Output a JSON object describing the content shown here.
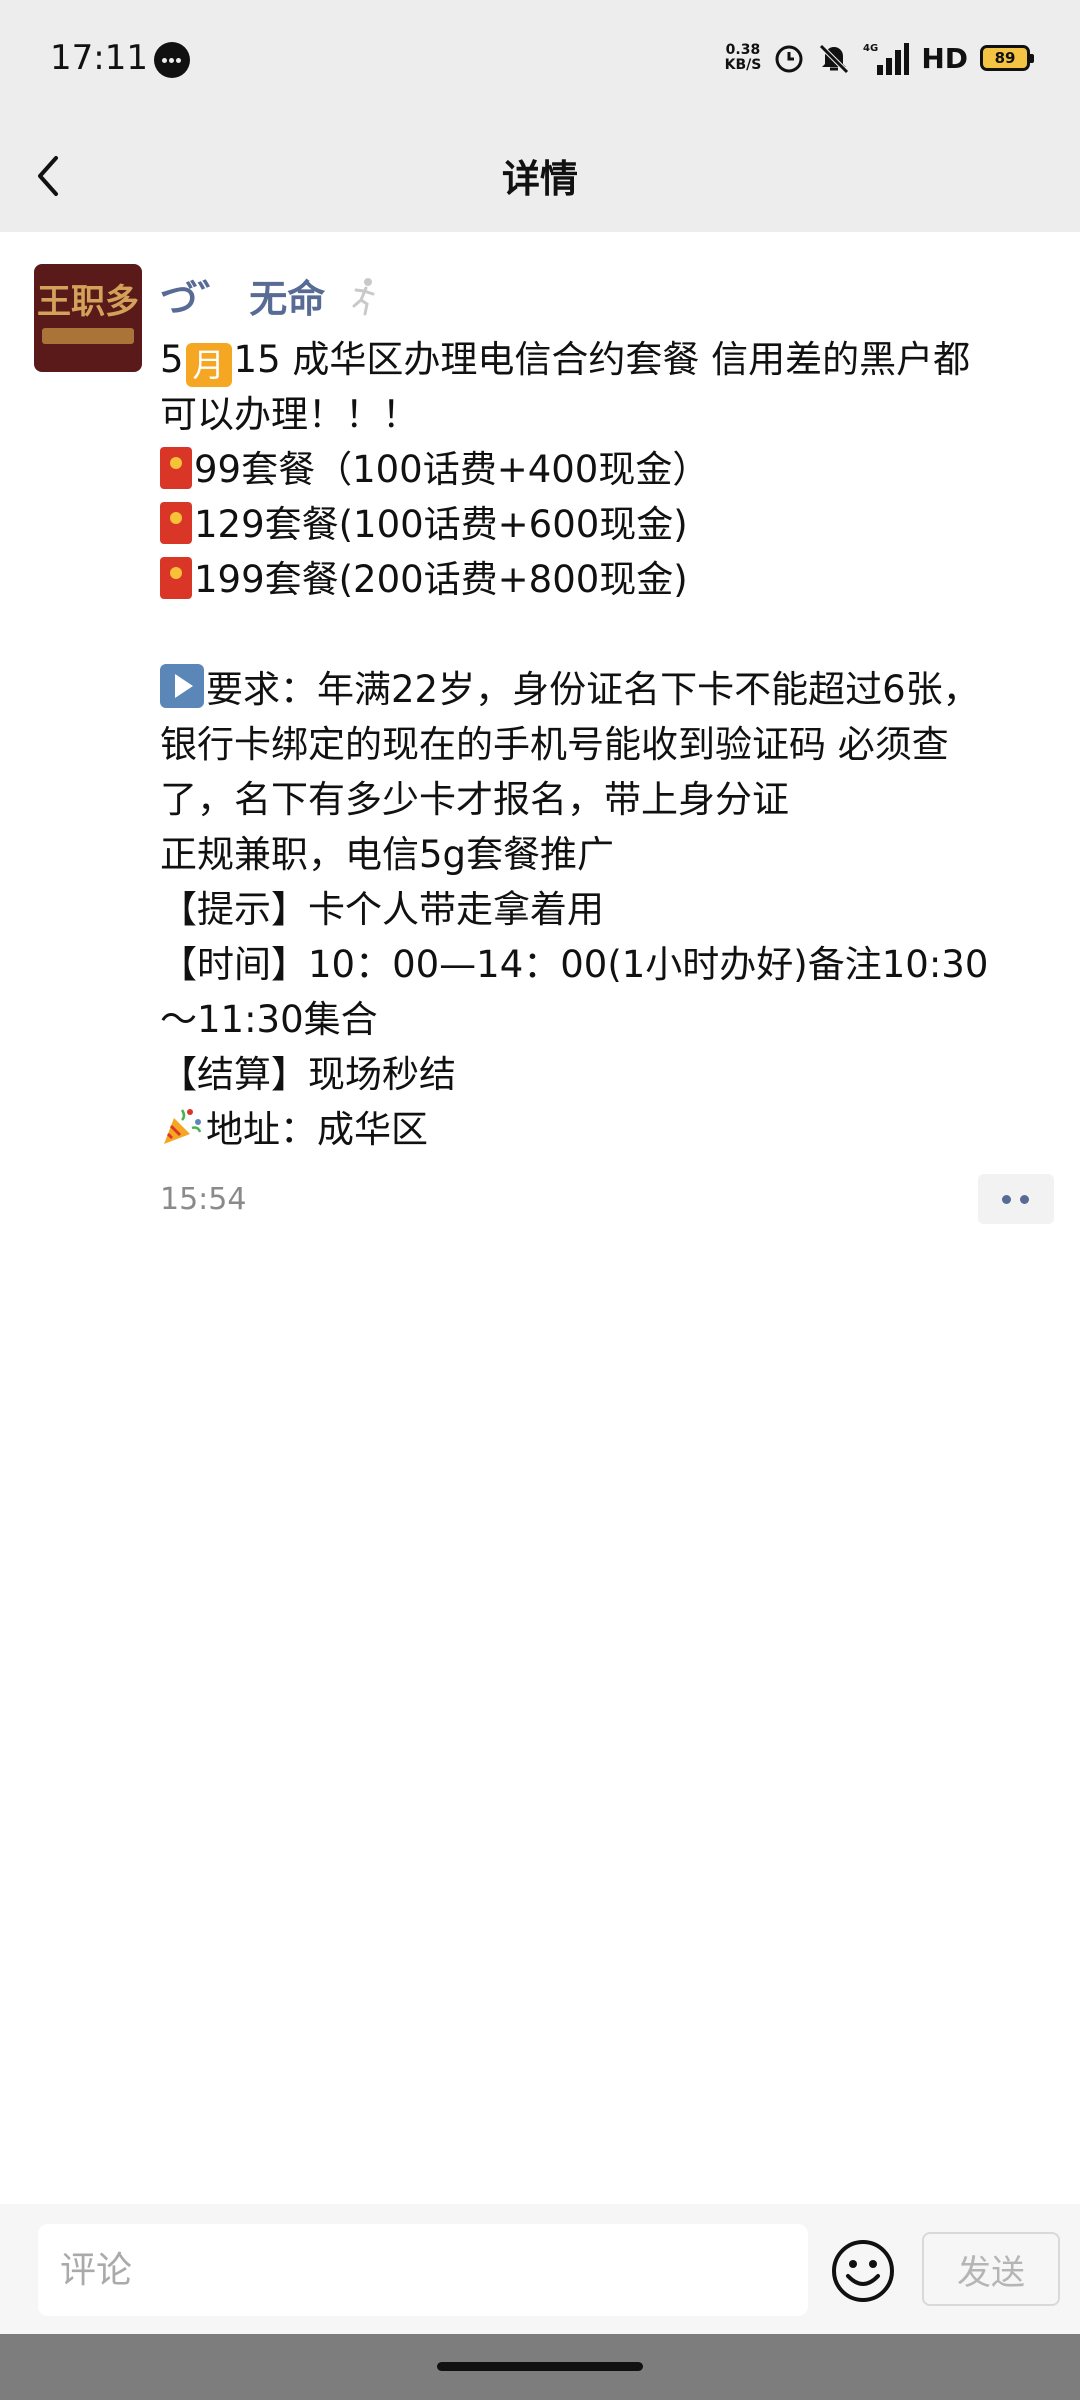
{
  "status_bar": {
    "time": "17:11",
    "net_speed_value": "0.38",
    "net_speed_unit": "KB/S",
    "network_badge": "4G",
    "hd_label": "HD",
    "battery_level": "89"
  },
  "nav": {
    "title": "详情"
  },
  "post": {
    "author": "づ゛ 无命",
    "timestamp": "15:54",
    "line_1a": "5",
    "month_emoji_text": "月",
    "line_1b": "15 成华区办理电信合约套餐 信用差的黑户都",
    "line_2": "可以办理！！！",
    "plan_1": "99套餐（100话费+400现金）",
    "plan_2": "129套餐(100话费+600现金)",
    "plan_3": "199套餐(200话费+800现金)",
    "requirement_line_1": "要求：年满22岁，身份证名下卡不能超过6张，",
    "requirement_line_2": "银行卡绑定的现在的手机号能收到验证码  必须查",
    "requirement_line_3": "了，名下有多少卡才报名，带上身分证",
    "requirement_line_4": "正规兼职，电信5g套餐推广",
    "tip_line": "【提示】卡个人带走拿着用",
    "time_line_1": "【时间】10：00—14：00(1小时办好)备注10:30",
    "time_line_2": "～11:30集合",
    "settlement_line": "【结算】现场秒结",
    "address_line": "地址：成华区"
  },
  "comment_bar": {
    "placeholder": "评论",
    "send_label": "发送"
  },
  "icons": {
    "back": "chevron-left-icon",
    "runner": "runner-icon",
    "red_envelope": "red-envelope-icon",
    "play": "play-button-icon",
    "party": "party-popper-icon",
    "emoji": "smiley-icon",
    "more": "more-dots-icon"
  },
  "colors": {
    "header_bg": "#ededed",
    "author_name": "#576b95",
    "battery_fill": "#f3c443"
  }
}
